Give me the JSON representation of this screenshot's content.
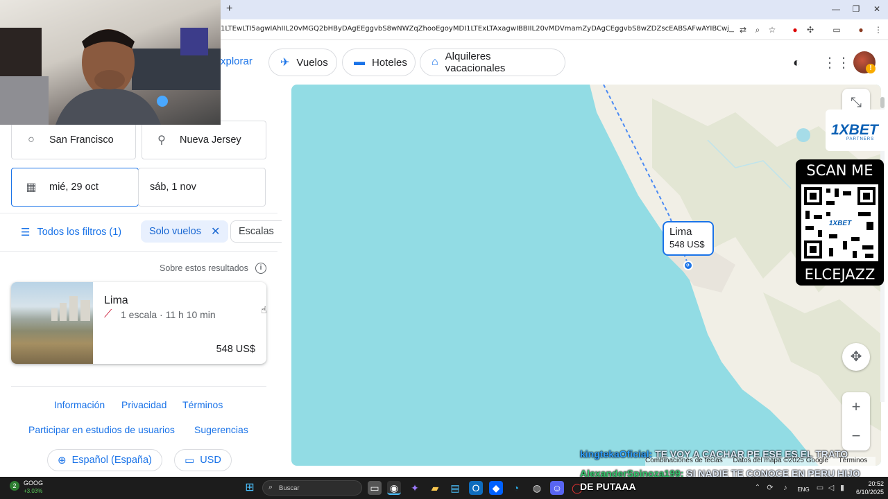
{
  "browser": {
    "new_tab": "+",
    "url": "1LTEwLTI5agwIAhIIL20vMGQ2bHByDAgEEggvbS8wNWZqZhooEgoyMDI1LTExLTAxagwIBBIIL20vMDVmamZyDAgCEggvbS8wZDZscEABSAFwAYIBCwj___________8BmAEBsgEEGAEgA..."
  },
  "header": {
    "explore_label": "xplorar",
    "tabs": [
      {
        "label": "Vuelos",
        "icon": "airplane-icon"
      },
      {
        "label": "Hoteles",
        "icon": "bed-icon"
      },
      {
        "label": "Alquileres vacacionales",
        "icon": "house-icon"
      }
    ]
  },
  "search": {
    "origin": "San Francisco",
    "destination": "Nueva Jersey",
    "depart_date": "mié, 29 oct",
    "return_date": "sáb, 1 nov"
  },
  "filters": {
    "all_filters": "Todos los filtros (1)",
    "solo_vuelos": "Solo vuelos",
    "stops": "Escalas"
  },
  "results": {
    "about": "Sobre estos resultados",
    "cards": [
      {
        "city": "Lima",
        "details": "1 escala · 11 h 10 min",
        "price": "548 US$"
      }
    ]
  },
  "footer": {
    "links": [
      "Información",
      "Privacidad",
      "Términos",
      "Participar en estudios de usuarios",
      "Sugerencias"
    ],
    "language": "Español (España)",
    "currency": "USD"
  },
  "map": {
    "label_city": "Lima",
    "label_price": "548 US$",
    "attribution": [
      "Combinaciones de teclas",
      "Datos del mapa ©2025 Google",
      "Términos"
    ],
    "water_color": "#92dce4",
    "land_color": "#f1efe6"
  },
  "overlay": {
    "qr_top": "SCAN ME",
    "qr_bottom": "ELCEJAZZ",
    "brand": "1XBET",
    "brand_sub": "PARTNERS",
    "qr_center": "1XBET",
    "chat": [
      {
        "user": "kingtekaOficial:",
        "msg": "TE VOY A CACHAR PE ESE ES EL TRATO"
      },
      {
        "user": "AlexanderSpinoza199:",
        "msg": "SI NADIE TE CONOCE EN PERU HIJO"
      }
    ]
  },
  "taskbar": {
    "stock_name": "GOOG",
    "stock_change": "+3.03%",
    "stock_badge": "2",
    "search_placeholder": "Buscar",
    "active_window": "DE PUTAAA",
    "lang": "ENG",
    "time": "20:52",
    "date": "6/10/2025"
  }
}
